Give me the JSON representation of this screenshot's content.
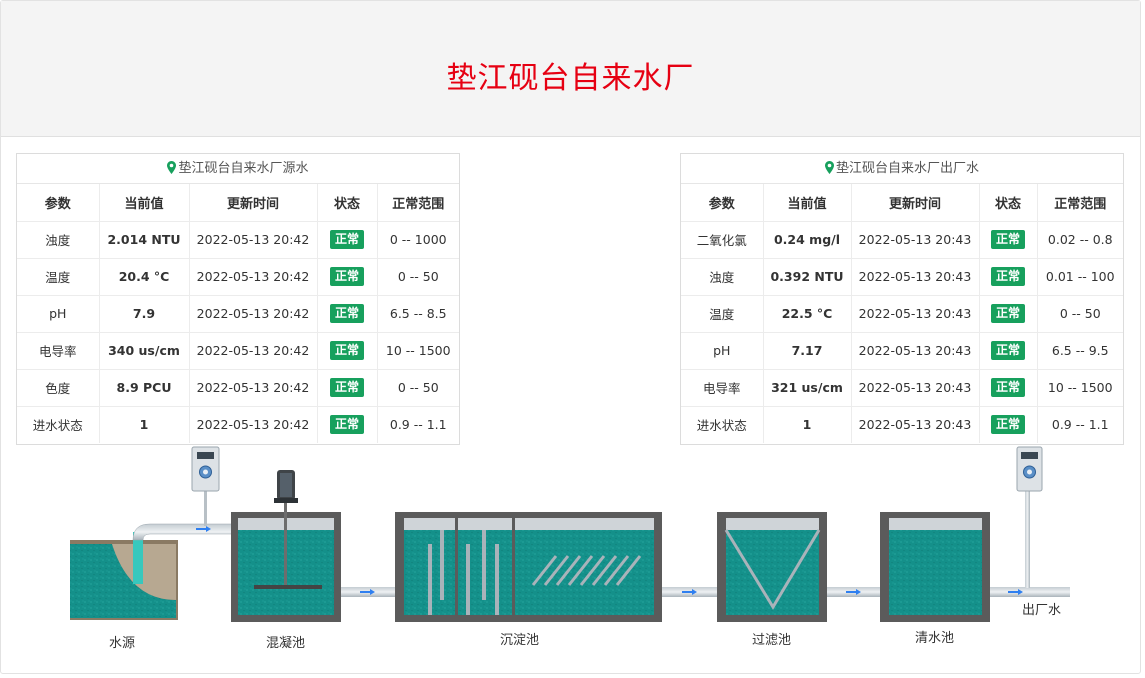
{
  "header": {
    "title": "垫江砚台自来水厂"
  },
  "colors": {
    "title": "#e60012",
    "status_normal": "#17a05d",
    "water": "#14908a",
    "pin": "#17a05d"
  },
  "source_panel": {
    "title": "垫江砚台自来水厂源水",
    "columns": [
      "参数",
      "当前值",
      "更新时间",
      "状态",
      "正常范围"
    ],
    "rows": [
      {
        "param": "浊度",
        "value": "2.014 NTU",
        "time": "2022-05-13 20:42",
        "status": "正常",
        "range": "0 -- 1000"
      },
      {
        "param": "温度",
        "value": "20.4 °C",
        "time": "2022-05-13 20:42",
        "status": "正常",
        "range": "0 -- 50"
      },
      {
        "param": "pH",
        "value": "7.9",
        "time": "2022-05-13 20:42",
        "status": "正常",
        "range": "6.5 -- 8.5"
      },
      {
        "param": "电导率",
        "value": "340 us/cm",
        "time": "2022-05-13 20:42",
        "status": "正常",
        "range": "10 -- 1500"
      },
      {
        "param": "色度",
        "value": "8.9 PCU",
        "time": "2022-05-13 20:42",
        "status": "正常",
        "range": "0 -- 50"
      },
      {
        "param": "进水状态",
        "value": "1",
        "time": "2022-05-13 20:42",
        "status": "正常",
        "range": "0.9 -- 1.1"
      }
    ]
  },
  "outlet_panel": {
    "title": "垫江砚台自来水厂出厂水",
    "columns": [
      "参数",
      "当前值",
      "更新时间",
      "状态",
      "正常范围"
    ],
    "rows": [
      {
        "param": "二氧化氯",
        "value": "0.24 mg/l",
        "time": "2022-05-13 20:43",
        "status": "正常",
        "range": "0.02 -- 0.8"
      },
      {
        "param": "浊度",
        "value": "0.392 NTU",
        "time": "2022-05-13 20:43",
        "status": "正常",
        "range": "0.01 -- 100"
      },
      {
        "param": "温度",
        "value": "22.5 °C",
        "time": "2022-05-13 20:43",
        "status": "正常",
        "range": "0 -- 50"
      },
      {
        "param": "pH",
        "value": "7.17",
        "time": "2022-05-13 20:43",
        "status": "正常",
        "range": "6.5 -- 9.5"
      },
      {
        "param": "电导率",
        "value": "321 us/cm",
        "time": "2022-05-13 20:43",
        "status": "正常",
        "range": "10 -- 1500"
      },
      {
        "param": "进水状态",
        "value": "1",
        "time": "2022-05-13 20:43",
        "status": "正常",
        "range": "0.9 -- 1.1"
      }
    ]
  },
  "process": {
    "water_source": "水源",
    "coagulation": "混凝池",
    "sedimentation": "沉淀池",
    "filtration": "过滤池",
    "clear_water": "清水池",
    "outlet": "出厂水"
  },
  "icons": {
    "location": "map-pin-icon",
    "monitor": "water-quality-analyzer-icon",
    "motor": "mixer-motor-icon"
  }
}
